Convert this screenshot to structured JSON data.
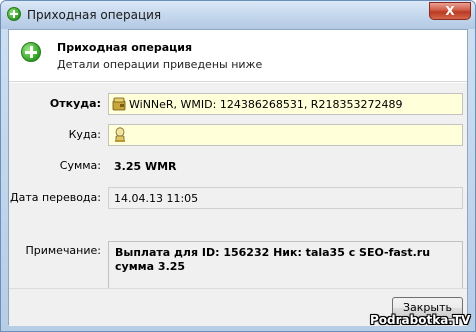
{
  "window": {
    "title": "Приходная операция",
    "close_symbol": "X",
    "icon": "green-plus-icon"
  },
  "header": {
    "title": "Приходная операция",
    "subtitle": "Детали операции приведены ниже",
    "icon": "green-plus-icon"
  },
  "fields": {
    "from_label": "Откуда:",
    "from_value": "WiNNeR, WMID: 124386268531, R218353272489",
    "from_icon": "purse-icon",
    "to_label": "Куда:",
    "to_value": "",
    "to_icon": "bank-icon",
    "amount_label": "Сумма:",
    "amount_value": "3.25 WMR",
    "date_label": "Дата перевода:",
    "date_value": "14.04.13 11:05",
    "note_label": "Примечание:",
    "note_line1": "Выплата для ID: 156232 Ник: tala35 с SEO-fast.ru",
    "note_line2": "сумма 3.25"
  },
  "footer": {
    "close_label": "Закрыть"
  },
  "watermark": "Podrabotka.TV",
  "colors": {
    "title_bar": "#c3d6ec",
    "close_button": "#c8472f",
    "field_highlight": "#ffffd9",
    "body_background": "#f0f0f0"
  }
}
